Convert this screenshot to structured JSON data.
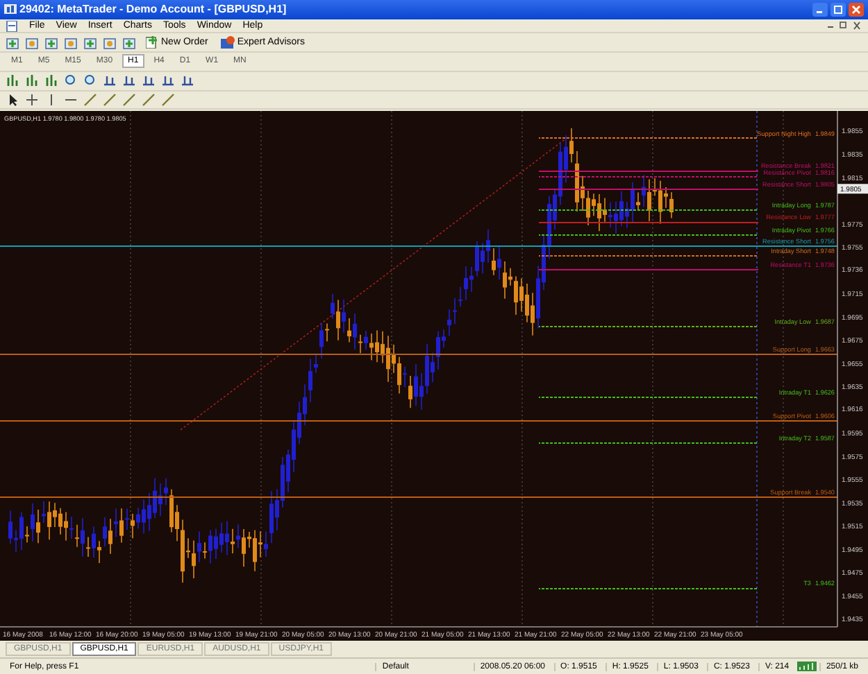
{
  "window": {
    "title": "29402: MetaTrader - Demo Account - [GBPUSD,H1]"
  },
  "menu": [
    "File",
    "View",
    "Insert",
    "Charts",
    "Tools",
    "Window",
    "Help"
  ],
  "toolbar": {
    "buttons": [
      {
        "label": "New Order",
        "kind": "order"
      },
      {
        "label": "Expert Advisors",
        "kind": "experts"
      }
    ]
  },
  "timeframes": [
    {
      "label": "M1",
      "selected": false
    },
    {
      "label": "M5",
      "selected": false
    },
    {
      "label": "M15",
      "selected": false
    },
    {
      "label": "M30",
      "selected": false
    },
    {
      "label": "H1",
      "selected": true
    },
    {
      "label": "H4",
      "selected": false
    },
    {
      "label": "D1",
      "selected": false
    },
    {
      "label": "W1",
      "selected": false
    },
    {
      "label": "MN",
      "selected": false
    }
  ],
  "chart": {
    "info": "GBPUSD,H1 1.9780 1.9800 1.9780 1.9805",
    "current_price": "1.9805",
    "levels": [
      {
        "label": "Support Night High",
        "price": "1.9849",
        "color": "#e07020",
        "full": false
      },
      {
        "label": "Resistance Break",
        "price": "1.9821",
        "color": "#c0106a",
        "full": false
      },
      {
        "label": "Resistance Pivot",
        "price": "1.9816",
        "color": "#c0106a",
        "full": false
      },
      {
        "label": "Resistance Short",
        "price": "1.9805",
        "color": "#c0106a",
        "full": false
      },
      {
        "label": "Intraday Long",
        "price": "1.9787",
        "color": "#40c020",
        "full": false
      },
      {
        "label": "Resistance Low",
        "price": "1.9777",
        "color": "#c02020",
        "full": false
      },
      {
        "label": "Intraday Pivot",
        "price": "1.9766",
        "color": "#40c020",
        "full": false
      },
      {
        "label": "Resistance Short",
        "price": "1.9756",
        "color": "#10a0b0",
        "full": true
      },
      {
        "label": "Intraday Short",
        "price": "1.9748",
        "color": "#d07020",
        "full": false
      },
      {
        "label": "Resistance T1",
        "price": "1.9736",
        "color": "#c0106a",
        "full": false
      },
      {
        "label": "Intraday Low",
        "price": "1.9687",
        "color": "#60b020",
        "full": false
      },
      {
        "label": "Support Long",
        "price": "1.9663",
        "color": "#b06020",
        "full": true
      },
      {
        "label": "Intraday T1",
        "price": "1.9626",
        "color": "#40c020",
        "full": false
      },
      {
        "label": "Support Pivot",
        "price": "1.9606",
        "color": "#c06010",
        "full": true
      },
      {
        "label": "Intraday T2",
        "price": "1.9587",
        "color": "#40c020",
        "full": false
      },
      {
        "label": "Support Break",
        "price": "1.9540",
        "color": "#c06010",
        "full": true
      },
      {
        "label": "T3",
        "price": "1.9462",
        "color": "#40c020",
        "full": false
      }
    ],
    "price_axis": [
      "1.9855",
      "1.9835",
      "1.9815",
      "1.9775",
      "1.9755",
      "1.9736",
      "1.9715",
      "1.9695",
      "1.9675",
      "1.9655",
      "1.9635",
      "1.9616",
      "1.9595",
      "1.9575",
      "1.9555",
      "1.9535",
      "1.9515",
      "1.9495",
      "1.9475",
      "1.9455",
      "1.9435"
    ],
    "time_axis": [
      "16 May 2008",
      "16 May 12:00",
      "16 May 20:00",
      "19 May 05:00",
      "19 May 13:00",
      "19 May 21:00",
      "20 May 05:00",
      "20 May 13:00",
      "20 May 21:00",
      "21 May 05:00",
      "21 May 13:00",
      "21 May 21:00",
      "22 May 05:00",
      "22 May 13:00",
      "22 May 21:00",
      "23 May 05:00"
    ]
  },
  "tabs": [
    {
      "label": "GBPUSD,H1",
      "selected": false
    },
    {
      "label": "GBPUSD,H1",
      "selected": true
    },
    {
      "label": "EURUSD,H1",
      "selected": false
    },
    {
      "label": "AUDUSD,H1",
      "selected": false
    },
    {
      "label": "USDJPY,H1",
      "selected": false
    }
  ],
  "status_bar": {
    "help": "For Help, press F1",
    "profile": "Default",
    "time": "2008.05.20 06:00",
    "open": "O: 1.9515",
    "high": "H: 1.9525",
    "low": "L: 1.9503",
    "close": "C: 1.9523",
    "volume": "V: 214",
    "traffic": "250/1 kb"
  }
}
